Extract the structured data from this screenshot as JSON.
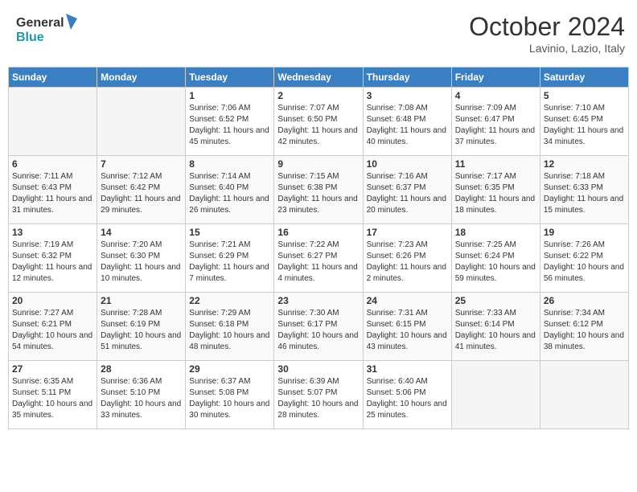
{
  "header": {
    "logo_line1": "General",
    "logo_line2": "Blue",
    "month": "October 2024",
    "location": "Lavinio, Lazio, Italy"
  },
  "days_of_week": [
    "Sunday",
    "Monday",
    "Tuesday",
    "Wednesday",
    "Thursday",
    "Friday",
    "Saturday"
  ],
  "weeks": [
    [
      {
        "day": "",
        "info": ""
      },
      {
        "day": "",
        "info": ""
      },
      {
        "day": "1",
        "info": "Sunrise: 7:06 AM\nSunset: 6:52 PM\nDaylight: 11 hours and 45 minutes."
      },
      {
        "day": "2",
        "info": "Sunrise: 7:07 AM\nSunset: 6:50 PM\nDaylight: 11 hours and 42 minutes."
      },
      {
        "day": "3",
        "info": "Sunrise: 7:08 AM\nSunset: 6:48 PM\nDaylight: 11 hours and 40 minutes."
      },
      {
        "day": "4",
        "info": "Sunrise: 7:09 AM\nSunset: 6:47 PM\nDaylight: 11 hours and 37 minutes."
      },
      {
        "day": "5",
        "info": "Sunrise: 7:10 AM\nSunset: 6:45 PM\nDaylight: 11 hours and 34 minutes."
      }
    ],
    [
      {
        "day": "6",
        "info": "Sunrise: 7:11 AM\nSunset: 6:43 PM\nDaylight: 11 hours and 31 minutes."
      },
      {
        "day": "7",
        "info": "Sunrise: 7:12 AM\nSunset: 6:42 PM\nDaylight: 11 hours and 29 minutes."
      },
      {
        "day": "8",
        "info": "Sunrise: 7:14 AM\nSunset: 6:40 PM\nDaylight: 11 hours and 26 minutes."
      },
      {
        "day": "9",
        "info": "Sunrise: 7:15 AM\nSunset: 6:38 PM\nDaylight: 11 hours and 23 minutes."
      },
      {
        "day": "10",
        "info": "Sunrise: 7:16 AM\nSunset: 6:37 PM\nDaylight: 11 hours and 20 minutes."
      },
      {
        "day": "11",
        "info": "Sunrise: 7:17 AM\nSunset: 6:35 PM\nDaylight: 11 hours and 18 minutes."
      },
      {
        "day": "12",
        "info": "Sunrise: 7:18 AM\nSunset: 6:33 PM\nDaylight: 11 hours and 15 minutes."
      }
    ],
    [
      {
        "day": "13",
        "info": "Sunrise: 7:19 AM\nSunset: 6:32 PM\nDaylight: 11 hours and 12 minutes."
      },
      {
        "day": "14",
        "info": "Sunrise: 7:20 AM\nSunset: 6:30 PM\nDaylight: 11 hours and 10 minutes."
      },
      {
        "day": "15",
        "info": "Sunrise: 7:21 AM\nSunset: 6:29 PM\nDaylight: 11 hours and 7 minutes."
      },
      {
        "day": "16",
        "info": "Sunrise: 7:22 AM\nSunset: 6:27 PM\nDaylight: 11 hours and 4 minutes."
      },
      {
        "day": "17",
        "info": "Sunrise: 7:23 AM\nSunset: 6:26 PM\nDaylight: 11 hours and 2 minutes."
      },
      {
        "day": "18",
        "info": "Sunrise: 7:25 AM\nSunset: 6:24 PM\nDaylight: 10 hours and 59 minutes."
      },
      {
        "day": "19",
        "info": "Sunrise: 7:26 AM\nSunset: 6:22 PM\nDaylight: 10 hours and 56 minutes."
      }
    ],
    [
      {
        "day": "20",
        "info": "Sunrise: 7:27 AM\nSunset: 6:21 PM\nDaylight: 10 hours and 54 minutes."
      },
      {
        "day": "21",
        "info": "Sunrise: 7:28 AM\nSunset: 6:19 PM\nDaylight: 10 hours and 51 minutes."
      },
      {
        "day": "22",
        "info": "Sunrise: 7:29 AM\nSunset: 6:18 PM\nDaylight: 10 hours and 48 minutes."
      },
      {
        "day": "23",
        "info": "Sunrise: 7:30 AM\nSunset: 6:17 PM\nDaylight: 10 hours and 46 minutes."
      },
      {
        "day": "24",
        "info": "Sunrise: 7:31 AM\nSunset: 6:15 PM\nDaylight: 10 hours and 43 minutes."
      },
      {
        "day": "25",
        "info": "Sunrise: 7:33 AM\nSunset: 6:14 PM\nDaylight: 10 hours and 41 minutes."
      },
      {
        "day": "26",
        "info": "Sunrise: 7:34 AM\nSunset: 6:12 PM\nDaylight: 10 hours and 38 minutes."
      }
    ],
    [
      {
        "day": "27",
        "info": "Sunrise: 6:35 AM\nSunset: 5:11 PM\nDaylight: 10 hours and 35 minutes."
      },
      {
        "day": "28",
        "info": "Sunrise: 6:36 AM\nSunset: 5:10 PM\nDaylight: 10 hours and 33 minutes."
      },
      {
        "day": "29",
        "info": "Sunrise: 6:37 AM\nSunset: 5:08 PM\nDaylight: 10 hours and 30 minutes."
      },
      {
        "day": "30",
        "info": "Sunrise: 6:39 AM\nSunset: 5:07 PM\nDaylight: 10 hours and 28 minutes."
      },
      {
        "day": "31",
        "info": "Sunrise: 6:40 AM\nSunset: 5:06 PM\nDaylight: 10 hours and 25 minutes."
      },
      {
        "day": "",
        "info": ""
      },
      {
        "day": "",
        "info": ""
      }
    ]
  ]
}
